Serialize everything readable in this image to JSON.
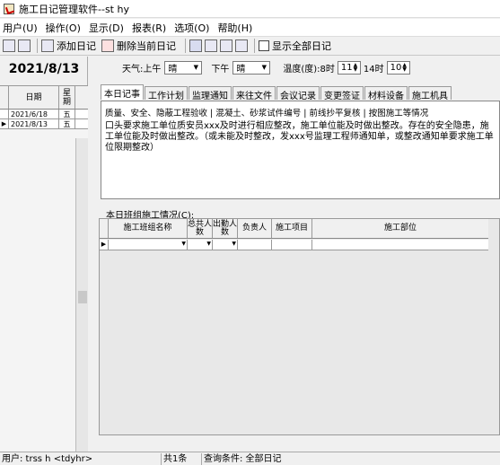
{
  "window": {
    "title": "施工日记管理软件--st hy"
  },
  "menu": [
    "用户(U)",
    "操作(O)",
    "显示(D)",
    "报表(R)",
    "选项(O)",
    "帮助(H)"
  ],
  "toolbar": {
    "add_label": "添加日记",
    "delete_label": "删除当前日记",
    "show_all_label": "显示全部日记"
  },
  "left": {
    "current_date": "2021/8/13",
    "col_date": "日期",
    "col_week": "星期",
    "rows": [
      {
        "date": "2021/6/18",
        "week": "五"
      },
      {
        "date": "2021/8/13",
        "week": "五"
      }
    ]
  },
  "weather": {
    "label": "天气:",
    "am_label": "上午",
    "am_value": "晴",
    "pm_label": "下午",
    "pm_value": "晴",
    "temp_label": "温度(度):",
    "t8_label": "8时",
    "t8_value": "11",
    "t14_label": "14时",
    "t14_value": "10"
  },
  "tabs": [
    "本日记事",
    "工作计划",
    "监理通知",
    "来往文件",
    "会议记录",
    "变更签证",
    "材料设备",
    "施工机具"
  ],
  "editor": {
    "quick_phrases": "质量、安全、隐蔽工程验收 | 混凝土、砂浆试件编号 | 前线抄平复核 | 按图施工等情况",
    "body": "口头要求施工单位质安员xxx及时进行相应整改，施工单位能及时做出整改。存在的安全隐患，施工单位能及时做出整改。（或未能及时整改，发xxx号监理工程师通知单，或整改通知单要求施工单位限期整改）"
  },
  "grid": {
    "label": "本日班组施工情况(C):",
    "columns": [
      "施工班组名称",
      "总共人数",
      "出勤人数",
      "负责人",
      "施工项目",
      "施工部位"
    ]
  },
  "status": {
    "user": "用户: trss h <tdyhr>",
    "count": "共1条",
    "query": "查询条件: 全部日记"
  },
  "colors": {
    "window_bg": "#f0f0f0",
    "editor_bg": "#ffffff"
  }
}
